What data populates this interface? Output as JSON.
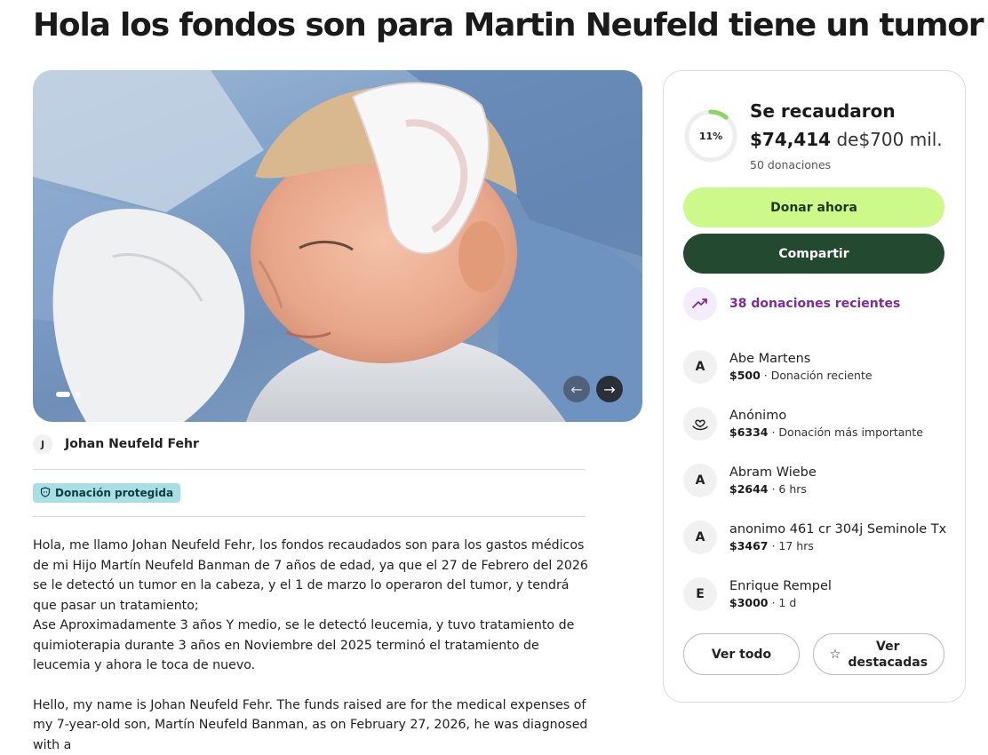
{
  "page": {
    "title": "Hola los fondos son para Martin Neufeld tiene un tumor"
  },
  "organizer": {
    "initial": "J",
    "name": "Johan Neufeld Fehr"
  },
  "badge": {
    "label": "Donación protegida"
  },
  "story": {
    "paragraph_es": "Hola, me llamo Johan Neufeld Fehr, los fondos recaudados son para los gastos médicos de mi Hijo Martín Neufeld Banman de 7 años de edad, ya que el 27 de Febrero del 2026 se le detectó un tumor en la cabeza, y el 1 de marzo lo operaron del tumor, y tendrá que pasar un tratamiento;",
    "paragraph_es_2": "Ase Aproximadamente 3 años Y medio, se le detectó leucemia, y tuvo tratamiento de quimioterapia durante 3 años en Noviembre del 2025 terminó el tratamiento de leucemia y ahora le toca de nuevo.",
    "paragraph_en": "Hello, my name is Johan Neufeld Fehr. The funds raised are for the medical expenses of my 7-year-old son, Martín Neufeld Banman, as on February 27, 2026, he was diagnosed with a"
  },
  "fundraiser": {
    "progress_percent": 11,
    "progress_label": "11%",
    "raised_label": "Se recaudaron",
    "amount": "$74,414",
    "goal_prefix": "de",
    "goal": "$700 mil.",
    "donation_count": "50 donaciones",
    "donate_label": "Donar ahora",
    "share_label": "Compartir",
    "recent_label": "38 donaciones recientes",
    "view_all_label": "Ver todo",
    "view_featured_label": "Ver destacadas",
    "progress_color": "#8cd65f",
    "accent_color": "#cdf88a"
  },
  "donors": [
    {
      "initial": "A",
      "icon": "",
      "name": "Abe Martens",
      "amount": "$500",
      "note": " · Donación reciente"
    },
    {
      "initial": "",
      "icon": "heart-hand-icon",
      "name": "Anónimo",
      "amount": "$6334",
      "note": " · Donación más importante"
    },
    {
      "initial": "A",
      "icon": "",
      "name": "Abram Wiebe",
      "amount": "$2644",
      "note": " · 6 hrs"
    },
    {
      "initial": "A",
      "icon": "",
      "name": "anonimo 461 cr 304j Seminole Tx",
      "amount": "$3467",
      "note": " · 17 hrs"
    },
    {
      "initial": "E",
      "icon": "",
      "name": "Enrique Rempel",
      "amount": "$3000",
      "note": " · 1 d"
    }
  ]
}
